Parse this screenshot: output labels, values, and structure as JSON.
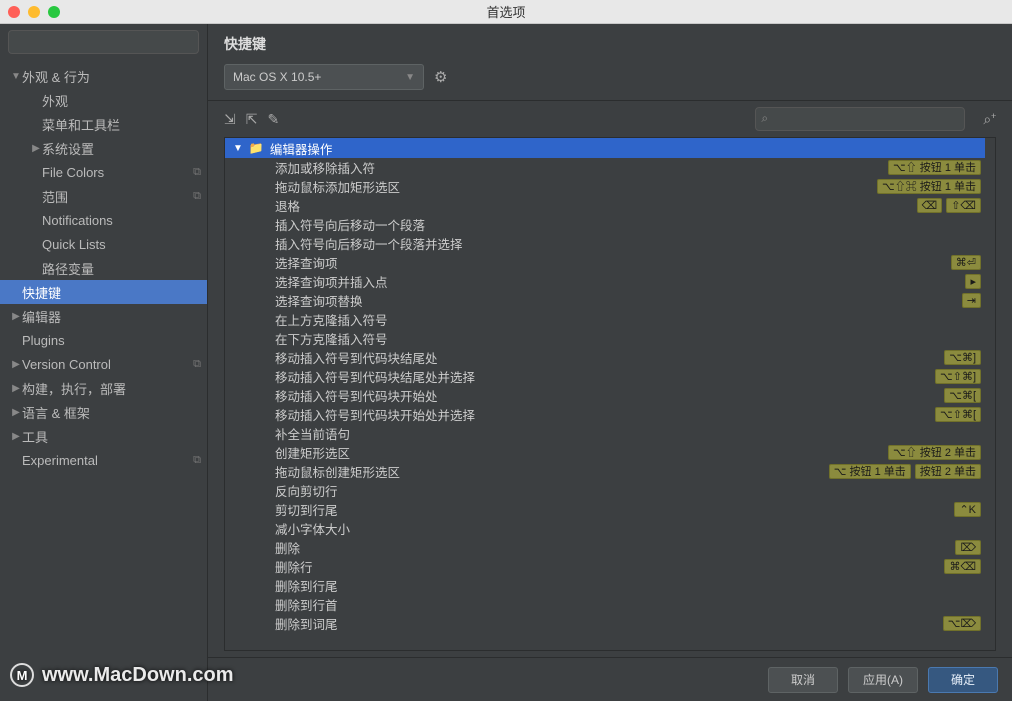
{
  "window": {
    "title": "首选项"
  },
  "sidebar": {
    "search_placeholder": "",
    "items": [
      {
        "label": "外观 & 行为",
        "depth": 0,
        "arrow": "▼",
        "badge": ""
      },
      {
        "label": "外观",
        "depth": 1,
        "arrow": "",
        "badge": ""
      },
      {
        "label": "菜单和工具栏",
        "depth": 1,
        "arrow": "",
        "badge": ""
      },
      {
        "label": "系统设置",
        "depth": 1,
        "arrow": "▶",
        "badge": ""
      },
      {
        "label": "File Colors",
        "depth": 1,
        "arrow": "",
        "badge": "⧉"
      },
      {
        "label": "范围",
        "depth": 1,
        "arrow": "",
        "badge": "⧉"
      },
      {
        "label": "Notifications",
        "depth": 1,
        "arrow": "",
        "badge": ""
      },
      {
        "label": "Quick Lists",
        "depth": 1,
        "arrow": "",
        "badge": ""
      },
      {
        "label": "路径变量",
        "depth": 1,
        "arrow": "",
        "badge": ""
      },
      {
        "label": "快捷键",
        "depth": 0,
        "arrow": "",
        "badge": "",
        "selected": true
      },
      {
        "label": "编辑器",
        "depth": 0,
        "arrow": "▶",
        "badge": ""
      },
      {
        "label": "Plugins",
        "depth": 0,
        "arrow": "",
        "badge": ""
      },
      {
        "label": "Version Control",
        "depth": 0,
        "arrow": "▶",
        "badge": "⧉"
      },
      {
        "label": "构建，执行，部署",
        "depth": 0,
        "arrow": "▶",
        "badge": ""
      },
      {
        "label": "语言 & 框架",
        "depth": 0,
        "arrow": "▶",
        "badge": ""
      },
      {
        "label": "工具",
        "depth": 0,
        "arrow": "▶",
        "badge": ""
      },
      {
        "label": "Experimental",
        "depth": 0,
        "arrow": "",
        "badge": "⧉"
      }
    ]
  },
  "main": {
    "title": "快捷键",
    "keymap_selected": "Mac OS X 10.5+",
    "search_placeholder": "",
    "group_label": "编辑器操作",
    "actions": [
      {
        "label": "添加或移除插入符",
        "shortcuts": [
          "⌥⇧ 按钮 1 单击"
        ]
      },
      {
        "label": "拖动鼠标添加矩形选区",
        "shortcuts": [
          "⌥⇧⌘ 按钮 1 单击"
        ]
      },
      {
        "label": "退格",
        "shortcuts": [
          "⌫",
          "⇧⌫"
        ]
      },
      {
        "label": "插入符号向后移动一个段落",
        "shortcuts": []
      },
      {
        "label": "插入符号向后移动一个段落并选择",
        "shortcuts": []
      },
      {
        "label": "选择查询项",
        "shortcuts": [
          "⌘⏎"
        ]
      },
      {
        "label": "选择查询项并插入点",
        "shortcuts": [
          "▸"
        ]
      },
      {
        "label": "选择查询项替换",
        "shortcuts": [
          "⇥"
        ]
      },
      {
        "label": "在上方克隆插入符号",
        "shortcuts": []
      },
      {
        "label": "在下方克隆插入符号",
        "shortcuts": []
      },
      {
        "label": "移动插入符号到代码块结尾处",
        "shortcuts": [
          "⌥⌘]"
        ]
      },
      {
        "label": "移动插入符号到代码块结尾处并选择",
        "shortcuts": [
          "⌥⇧⌘]"
        ]
      },
      {
        "label": "移动插入符号到代码块开始处",
        "shortcuts": [
          "⌥⌘["
        ]
      },
      {
        "label": "移动插入符号到代码块开始处并选择",
        "shortcuts": [
          "⌥⇧⌘["
        ]
      },
      {
        "label": "补全当前语句",
        "shortcuts": []
      },
      {
        "label": "创建矩形选区",
        "shortcuts": [
          "⌥⇧ 按钮 2 单击"
        ]
      },
      {
        "label": "拖动鼠标创建矩形选区",
        "shortcuts": [
          "⌥ 按钮 1 单击",
          "按钮 2 单击"
        ]
      },
      {
        "label": "反向剪切行",
        "shortcuts": []
      },
      {
        "label": "剪切到行尾",
        "shortcuts": [
          "⌃K"
        ]
      },
      {
        "label": "减小字体大小",
        "shortcuts": []
      },
      {
        "label": "删除",
        "shortcuts": [
          "⌦"
        ]
      },
      {
        "label": "删除行",
        "shortcuts": [
          "⌘⌫"
        ]
      },
      {
        "label": "删除到行尾",
        "shortcuts": []
      },
      {
        "label": "删除到行首",
        "shortcuts": []
      },
      {
        "label": "删除到词尾",
        "shortcuts": [
          "⌥⌦"
        ]
      }
    ]
  },
  "footer": {
    "cancel": "取消",
    "apply": "应用(A)",
    "ok": "确定"
  },
  "watermark": "www.MacDown.com"
}
